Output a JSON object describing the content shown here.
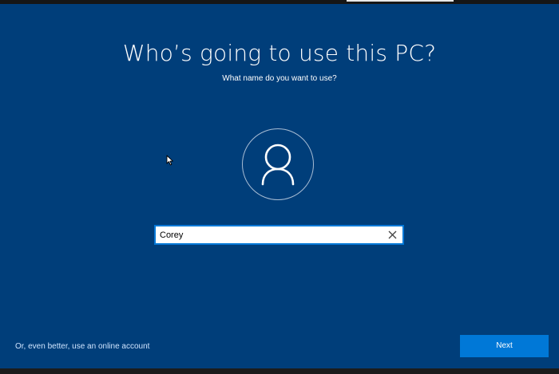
{
  "setup": {
    "title": "Who’s going to use this PC?",
    "subtitle": "What name do you want to use?"
  },
  "avatar": {
    "icon": "user-icon"
  },
  "name_field": {
    "value": "Corey",
    "clear_icon": "close-icon"
  },
  "footer": {
    "online_account_link": "Or, even better, use an online account",
    "next_label": "Next"
  },
  "progress": {
    "fraction": 0.19
  },
  "colors": {
    "background": "#003e7a",
    "accent": "#0078d7",
    "text": "#ffffff",
    "link": "#cfe4ff"
  }
}
